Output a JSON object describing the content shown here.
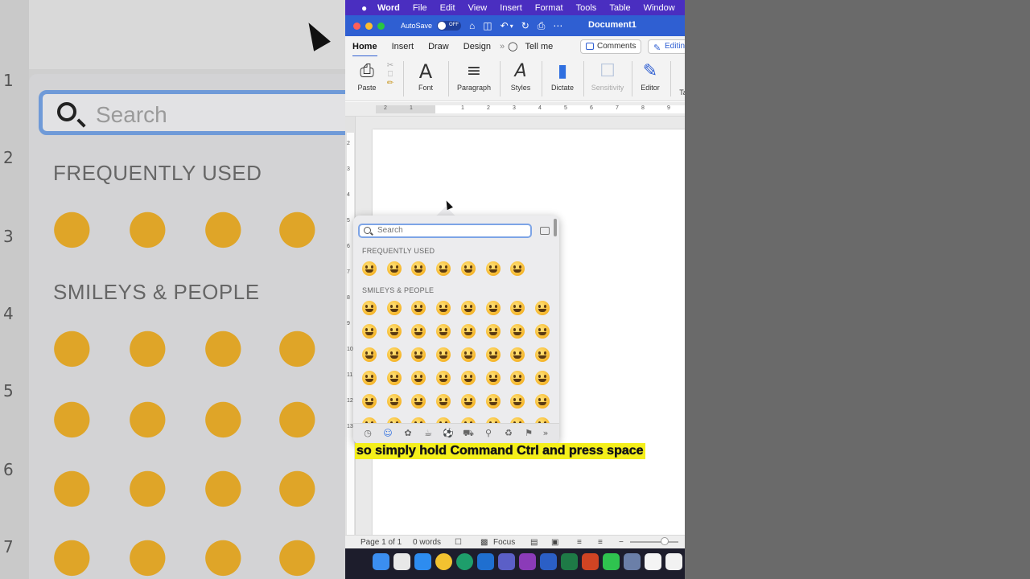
{
  "menubar": {
    "apple_icon": "apple-logo-icon",
    "app_name": "Word",
    "items": [
      "File",
      "Edit",
      "View",
      "Insert",
      "Format",
      "Tools",
      "Table",
      "Window"
    ]
  },
  "titlebar": {
    "autosave_label": "AutoSave",
    "autosave_state": "OFF",
    "document_title": "Document1",
    "icons": [
      "home-icon",
      "save-icon",
      "undo-icon",
      "redo-icon",
      "print-icon",
      "more-icon"
    ]
  },
  "tabs": {
    "items": [
      "Home",
      "Insert",
      "Draw",
      "Design"
    ],
    "active": "Home",
    "tell_me": "Tell me",
    "comments_label": "Comments",
    "editing_label": "Editing"
  },
  "ribbon": {
    "paste": "Paste",
    "font": "Font",
    "paragraph": "Paragraph",
    "styles": "Styles",
    "dictate": "Dictate",
    "sensitivity": "Sensitivity",
    "editor": "Editor",
    "partial": "Ta"
  },
  "ruler": {
    "h_ticks": [
      "2",
      "1",
      "1",
      "2",
      "3",
      "4",
      "5",
      "6",
      "7",
      "8",
      "9"
    ],
    "v_ticks": [
      "2",
      "3",
      "4",
      "5",
      "6",
      "7",
      "8",
      "9",
      "10",
      "11",
      "12",
      "13"
    ]
  },
  "emoji_picker": {
    "search_placeholder": "Search",
    "sections": [
      {
        "heading": "FREQUENTLY USED",
        "count": 7
      },
      {
        "heading": "SMILEYS & PEOPLE",
        "count": 48
      }
    ],
    "categories": [
      "clock-icon",
      "smiley-icon",
      "animal-icon",
      "food-icon",
      "ball-icon",
      "car-icon",
      "bulb-icon",
      "symbols-icon",
      "flag-icon",
      "more-icon"
    ],
    "active_category": "smiley-icon"
  },
  "statusbar": {
    "page": "Page 1 of 1",
    "words": "0 words",
    "focus": "Focus"
  },
  "background_zoom": {
    "search_placeholder": "Search",
    "headings": [
      "FREQUENTLY USED",
      "SMILEYS & PEOPLE"
    ],
    "ruler_numbers": [
      "1",
      "2",
      "3",
      "4",
      "5",
      "6",
      "7"
    ]
  },
  "caption": "so simply hold Command Ctrl and press space",
  "colors": {
    "menubar": "#4a2ec0",
    "titlebar": "#2f5fd2",
    "caption_bg": "#f4ef1a",
    "search_border": "#7da4e6"
  }
}
